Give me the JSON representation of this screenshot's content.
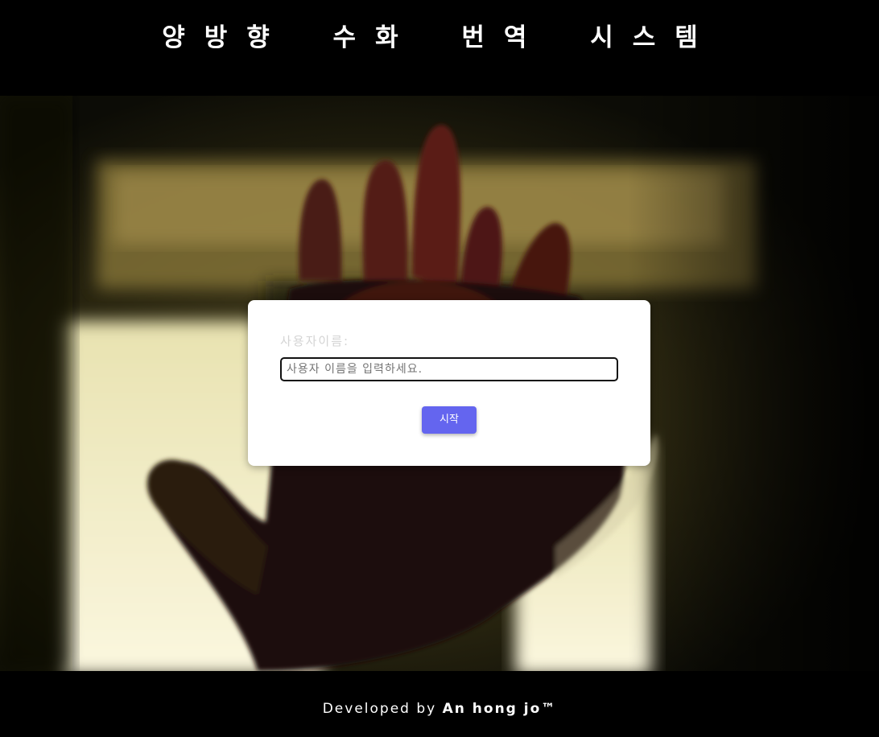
{
  "header": {
    "title": "양방향 수화 번역 시스템"
  },
  "hero": {
    "image": "hand-raised-toward-window-photo"
  },
  "login_card": {
    "username_label": "사용자이름:",
    "username_value": "",
    "username_placeholder": "사용자 이름을 입력하세요.",
    "start_button_label": "시작"
  },
  "footer": {
    "developed_by": "Developed by",
    "author": "An hong jo™"
  },
  "colors": {
    "header_bg": "#000000",
    "footer_bg": "#000000",
    "card_bg": "#ffffff",
    "button_bg": "#6465ef",
    "button_text": "#ffffff"
  }
}
